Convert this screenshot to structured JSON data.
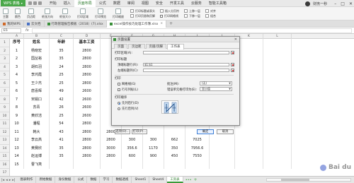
{
  "titlebar": {
    "app_button": "WPS 表格",
    "menu": [
      "开始",
      "插入",
      "页面布局",
      "公式",
      "数据",
      "审阅",
      "视图",
      "安全",
      "开发工具",
      "云服务",
      "智能工具箱"
    ],
    "active_menu": "页面布局",
    "user": "财务一秒"
  },
  "ribbon": {
    "items": [
      {
        "label": "主题"
      },
      {
        "label": "颜色"
      },
      {
        "label": "页边距"
      },
      {
        "label": "纸张方向"
      },
      {
        "label": "纸张大小"
      },
      {
        "label": "打印区域"
      },
      {
        "label": "打印预览"
      },
      {
        "label": "打印缩放"
      }
    ],
    "group1": [
      "打印标题或表头",
      "打印页眉和页脚"
    ],
    "group2": [
      "插入分页符",
      "打印网格线"
    ],
    "group3": [
      "上移一层",
      "下移一层",
      "选择窗格"
    ],
    "group4": [
      "对齐",
      "组合",
      "旋转"
    ]
  },
  "doctabs": [
    {
      "label": "我的WPS",
      "icon": "o",
      "active": false
    },
    {
      "label": "云文档",
      "icon": "b",
      "active": false
    },
    {
      "label": "行政管理报告模板（2018）(7).xlsx",
      "icon": "g",
      "active": false
    },
    {
      "label": "excel操作技巧处理工作簿.xlsx",
      "icon": "g",
      "active": true
    }
  ],
  "formulabar": {
    "namebox": "E5",
    "fx": "fx",
    "value": ""
  },
  "grid": {
    "columns": [
      "A",
      "B",
      "C",
      "D",
      "E",
      "F",
      "G",
      "H",
      "I",
      "J",
      "K",
      "L"
    ],
    "row_numbers": [
      "1",
      "2",
      "3",
      "4",
      "5",
      "6",
      "7",
      "8",
      "9",
      "10",
      "11",
      "12",
      "13",
      "14",
      "15",
      "16",
      "17"
    ],
    "header": [
      "序号",
      "姓名",
      "年龄",
      "基本工资",
      "",
      "",
      "",
      "",
      "",
      "",
      "",
      ""
    ],
    "rows": [
      [
        "1",
        "杨晓宏",
        "35",
        "2800",
        "",
        "",
        "",
        "",
        "",
        "",
        "",
        ""
      ],
      [
        "2",
        "国丛裕",
        "35",
        "2800",
        "",
        "",
        "",
        "",
        "",
        "",
        "",
        ""
      ],
      [
        "3",
        "胡石羽",
        "24",
        "2800",
        "",
        "",
        "",
        "",
        "",
        "",
        "",
        ""
      ],
      [
        "4",
        "李鸿霞",
        "25",
        "2800",
        "",
        "",
        "",
        "",
        "",
        "",
        "",
        ""
      ],
      [
        "5",
        "王少杰",
        "25",
        "2800",
        "",
        "",
        "",
        "",
        "",
        "",
        "",
        ""
      ],
      [
        "6",
        "唐喜辉",
        "49",
        "2600",
        "",
        "",
        "",
        "",
        "",
        "",
        "",
        ""
      ],
      [
        "7",
        "宋娟口",
        "42",
        "2600",
        "",
        "",
        "",
        "",
        "",
        "",
        "",
        ""
      ],
      [
        "8",
        "苏青",
        "26",
        "2600",
        "",
        "",
        "",
        "",
        "",
        "",
        "",
        ""
      ],
      [
        "9",
        "黄欣洁",
        "25",
        "2600",
        "",
        "",
        "",
        "",
        "",
        "",
        "",
        ""
      ],
      [
        "10",
        "潘程",
        "54",
        "2800",
        "",
        "",
        "",
        "",
        "",
        "",
        "",
        ""
      ],
      [
        "11",
        "韩大",
        "43",
        "2800",
        "2800",
        "",
        "",
        "",
        "",
        "",
        "",
        ""
      ],
      [
        "12",
        "李云高",
        "41",
        "2800",
        "2800",
        "300",
        "300",
        "662",
        "7025",
        "",
        "",
        ""
      ],
      [
        "13",
        "黄赛欣",
        "35",
        "2800",
        "3000",
        "356.6",
        "1170",
        "350",
        "7956.6",
        "",
        "",
        ""
      ],
      [
        "14",
        "赵运博",
        "35",
        "2800",
        "2800",
        "600",
        "900",
        "450",
        "7550",
        "",
        "",
        ""
      ],
      [
        "15",
        "曹飞夷",
        "",
        "",
        "",
        "",
        "",
        "",
        "",
        "",
        "",
        ""
      ]
    ]
  },
  "sheetbar": {
    "tabs": [
      "图表制作",
      "原始数据",
      "身份数据",
      "公式",
      "数据",
      "学习",
      "数据透视",
      "Sheet1",
      "Sheet4",
      "工资表"
    ],
    "active": "工资表"
  },
  "watermark": "Bai du",
  "dialog": {
    "title": "页面设置",
    "tabs": [
      "页面",
      "页边距",
      "页眉/页脚",
      "工作表"
    ],
    "active_tab": "工作表",
    "print_area_label": "打印区域(A):",
    "print_area_value": "",
    "print_titles_label": "打印标题",
    "top_rows_label": "顶端标题行(R):",
    "top_rows_value": "$1:$1",
    "left_cols_label": "左端标题列(C):",
    "left_cols_value": "",
    "print_label": "打印",
    "gridlines_label": "网格线(G)",
    "rowcol_label": "行号列标(L)",
    "comments_label": "批注(M):",
    "comments_value": "(无)",
    "errors_label": "错误单元格打印为(E):",
    "errors_value": "显示值",
    "order_label": "打印顺序",
    "order_down": "先列后行(D)",
    "order_over": "先行后列(V)",
    "options_btn": "选项(O)...",
    "print_btn": "打印(P)...",
    "ok_btn": "确定",
    "cancel_btn": "取消"
  }
}
